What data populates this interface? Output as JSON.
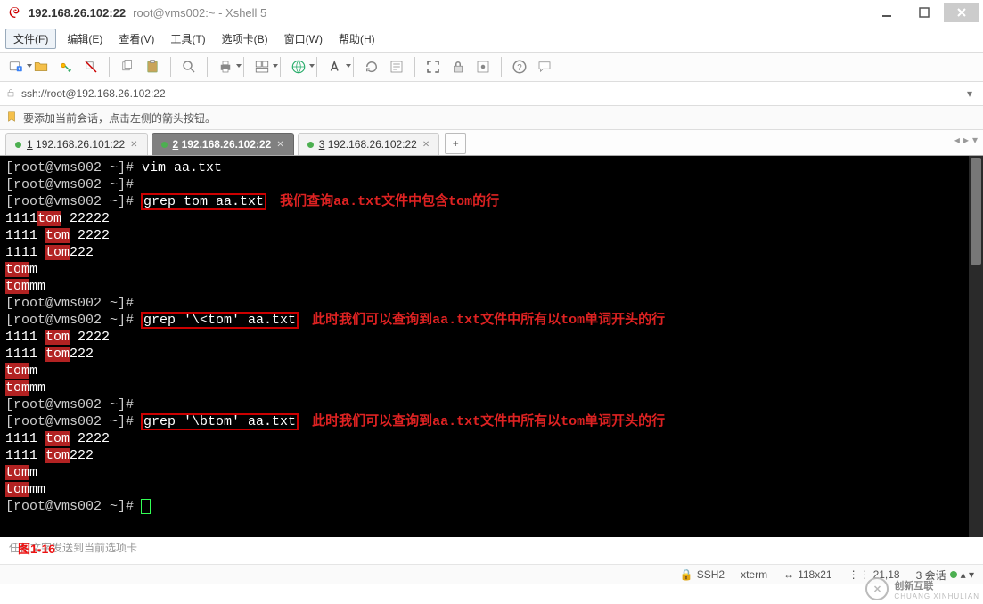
{
  "title": {
    "host": "192.168.26.102:22",
    "sub": "root@vms002:~ - Xshell 5"
  },
  "menu": {
    "file": "文件(F)",
    "items": [
      "编辑(E)",
      "查看(V)",
      "工具(T)",
      "选项卡(B)",
      "窗口(W)",
      "帮助(H)"
    ]
  },
  "addr": {
    "url": "ssh://root@192.168.26.102:22"
  },
  "hint": {
    "text": "要添加当前会话，点击左侧的箭头按钮。"
  },
  "tabs": [
    {
      "num": "1",
      "label": "192.168.26.101:22",
      "active": false
    },
    {
      "num": "2",
      "label": "192.168.26.102:22",
      "active": true
    },
    {
      "num": "3",
      "label": "192.168.26.102:22",
      "active": false
    }
  ],
  "term": {
    "lines": [
      {
        "type": "prompt",
        "prompt": "[root@vms002 ~]# ",
        "cmd": "vim aa.txt"
      },
      {
        "type": "prompt",
        "prompt": "[root@vms002 ~]# ",
        "cmd": ""
      },
      {
        "type": "promptbox",
        "prompt": "[root@vms002 ~]# ",
        "cmd": "grep tom aa.txt",
        "note": "我们查询aa.txt文件中包含tom的行"
      },
      {
        "type": "out",
        "pre": "1111",
        "hl": "tom",
        "post": " 22222"
      },
      {
        "type": "out",
        "pre": "1111 ",
        "hl": "tom",
        "post": " 2222"
      },
      {
        "type": "out",
        "pre": "1111 ",
        "hl": "tom",
        "post": "222"
      },
      {
        "type": "out",
        "pre": "",
        "hl": "tom",
        "post": "m"
      },
      {
        "type": "out",
        "pre": "",
        "hl": "tom",
        "post": "mm"
      },
      {
        "type": "prompt",
        "prompt": "[root@vms002 ~]# ",
        "cmd": ""
      },
      {
        "type": "promptbox",
        "prompt": "[root@vms002 ~]# ",
        "cmd": "grep '\\<tom' aa.txt",
        "note": "此时我们可以查询到aa.txt文件中所有以tom单词开头的行"
      },
      {
        "type": "out",
        "pre": "1111 ",
        "hl": "tom",
        "post": " 2222"
      },
      {
        "type": "out",
        "pre": "1111 ",
        "hl": "tom",
        "post": "222"
      },
      {
        "type": "out",
        "pre": "",
        "hl": "tom",
        "post": "m"
      },
      {
        "type": "out",
        "pre": "",
        "hl": "tom",
        "post": "mm"
      },
      {
        "type": "prompt",
        "prompt": "[root@vms002 ~]# ",
        "cmd": ""
      },
      {
        "type": "promptbox",
        "prompt": "[root@vms002 ~]# ",
        "cmd": "grep '\\btom' aa.txt",
        "note": "此时我们可以查询到aa.txt文件中所有以tom单词开头的行"
      },
      {
        "type": "out",
        "pre": "1111 ",
        "hl": "tom",
        "post": " 2222"
      },
      {
        "type": "out",
        "pre": "1111 ",
        "hl": "tom",
        "post": "222"
      },
      {
        "type": "out",
        "pre": "",
        "hl": "tom",
        "post": "m"
      },
      {
        "type": "out",
        "pre": "",
        "hl": "tom",
        "post": "mm"
      },
      {
        "type": "promptcursor",
        "prompt": "[root@vms002 ~]# "
      }
    ]
  },
  "underhint": "任何文字发送到当前选项卡",
  "figlabel": "图1-16",
  "status": {
    "proto": "SSH2",
    "termtype": "xterm",
    "size": "118x21",
    "pos": "21,18",
    "sess": "3 会话"
  },
  "brand": "创新互联"
}
